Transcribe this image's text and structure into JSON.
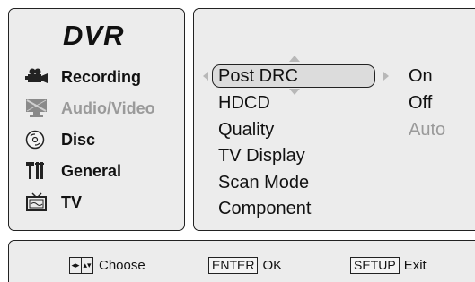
{
  "menu": {
    "title": "DVR",
    "items": [
      {
        "label": "Recording",
        "icon": "camcorder-icon",
        "state": "normal"
      },
      {
        "label": "Audio/Video",
        "icon": "audio-video-icon",
        "state": "disabled"
      },
      {
        "label": "Disc",
        "icon": "disc-icon",
        "state": "normal"
      },
      {
        "label": "General",
        "icon": "tools-icon",
        "state": "normal"
      },
      {
        "label": "TV",
        "icon": "tv-icon",
        "state": "normal"
      }
    ]
  },
  "settings": {
    "selected": "Post DRC",
    "options": [
      {
        "label": "Post DRC",
        "value": "On"
      },
      {
        "label": "HDCD",
        "value": "Off"
      },
      {
        "label": "Quality",
        "value": "Auto",
        "value_state": "disabled"
      },
      {
        "label": "TV Display"
      },
      {
        "label": "Scan Mode"
      },
      {
        "label": "Component"
      }
    ]
  },
  "footer": {
    "choose_label": "Choose",
    "enter_key": "ENTER",
    "ok_label": "OK",
    "setup_key": "SETUP",
    "exit_label": "Exit"
  },
  "colors": {
    "panel_bg": "#ececec",
    "disabled_text": "#9a9a9a"
  }
}
